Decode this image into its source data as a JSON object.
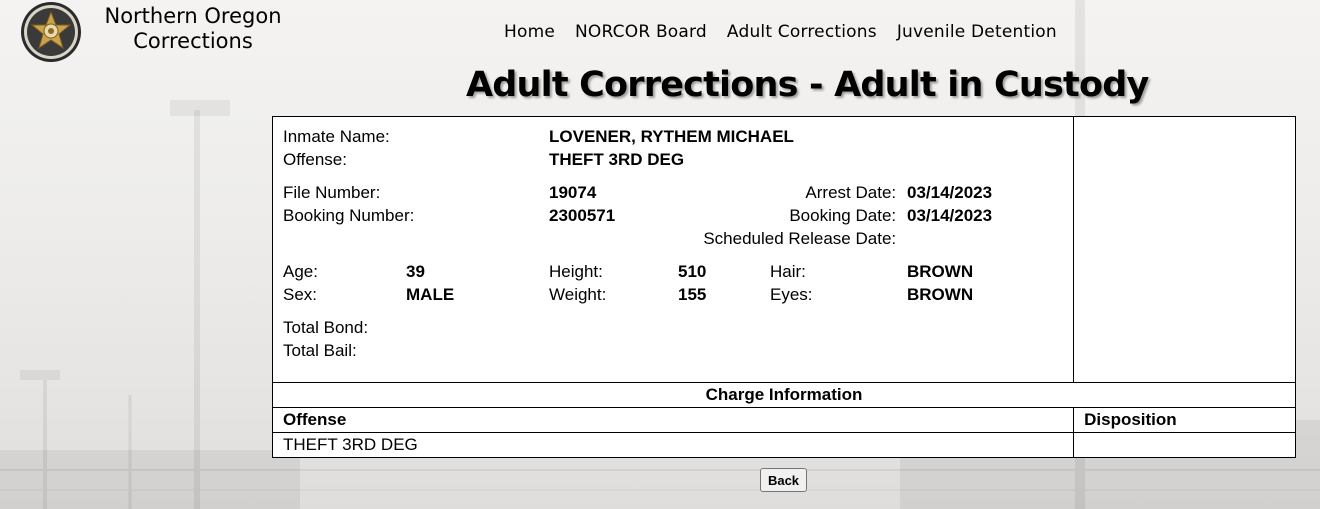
{
  "site": {
    "name_line1": "Northern Oregon",
    "name_line2": "Corrections",
    "logo_icon": "sheriff-star-badge-icon"
  },
  "nav": {
    "items": [
      "Home",
      "NORCOR Board",
      "Adult Corrections",
      "Juvenile Detention"
    ]
  },
  "page": {
    "title": "Adult Corrections - Adult in Custody"
  },
  "inmate": {
    "name_label": "Inmate Name:",
    "name": "LOVENER, RYTHEM MICHAEL",
    "offense_label": "Offense:",
    "offense": "THEFT 3RD DEG",
    "file_number_label": "File Number:",
    "file_number": "19074",
    "booking_number_label": "Booking Number:",
    "booking_number": "2300571",
    "arrest_date_label": "Arrest Date:",
    "arrest_date": "03/14/2023",
    "booking_date_label": "Booking Date:",
    "booking_date": "03/14/2023",
    "release_date_label": "Scheduled Release Date:",
    "release_date": "",
    "age_label": "Age:",
    "age": "39",
    "sex_label": "Sex:",
    "sex": "MALE",
    "height_label": "Height:",
    "height": "510",
    "weight_label": "Weight:",
    "weight": "155",
    "hair_label": "Hair:",
    "hair": "BROWN",
    "eyes_label": "Eyes:",
    "eyes": "BROWN",
    "total_bond_label": "Total Bond:",
    "total_bond": "",
    "total_bail_label": "Total Bail:",
    "total_bail": ""
  },
  "charges": {
    "section_title": "Charge Information",
    "columns": [
      "Offense",
      "Disposition"
    ],
    "rows": [
      {
        "offense": "THEFT 3RD DEG",
        "disposition": ""
      }
    ]
  },
  "actions": {
    "back_label": "Back"
  },
  "colors": {
    "background": "#eeedeb",
    "table_background": "#ffffff",
    "border": "#000000"
  }
}
